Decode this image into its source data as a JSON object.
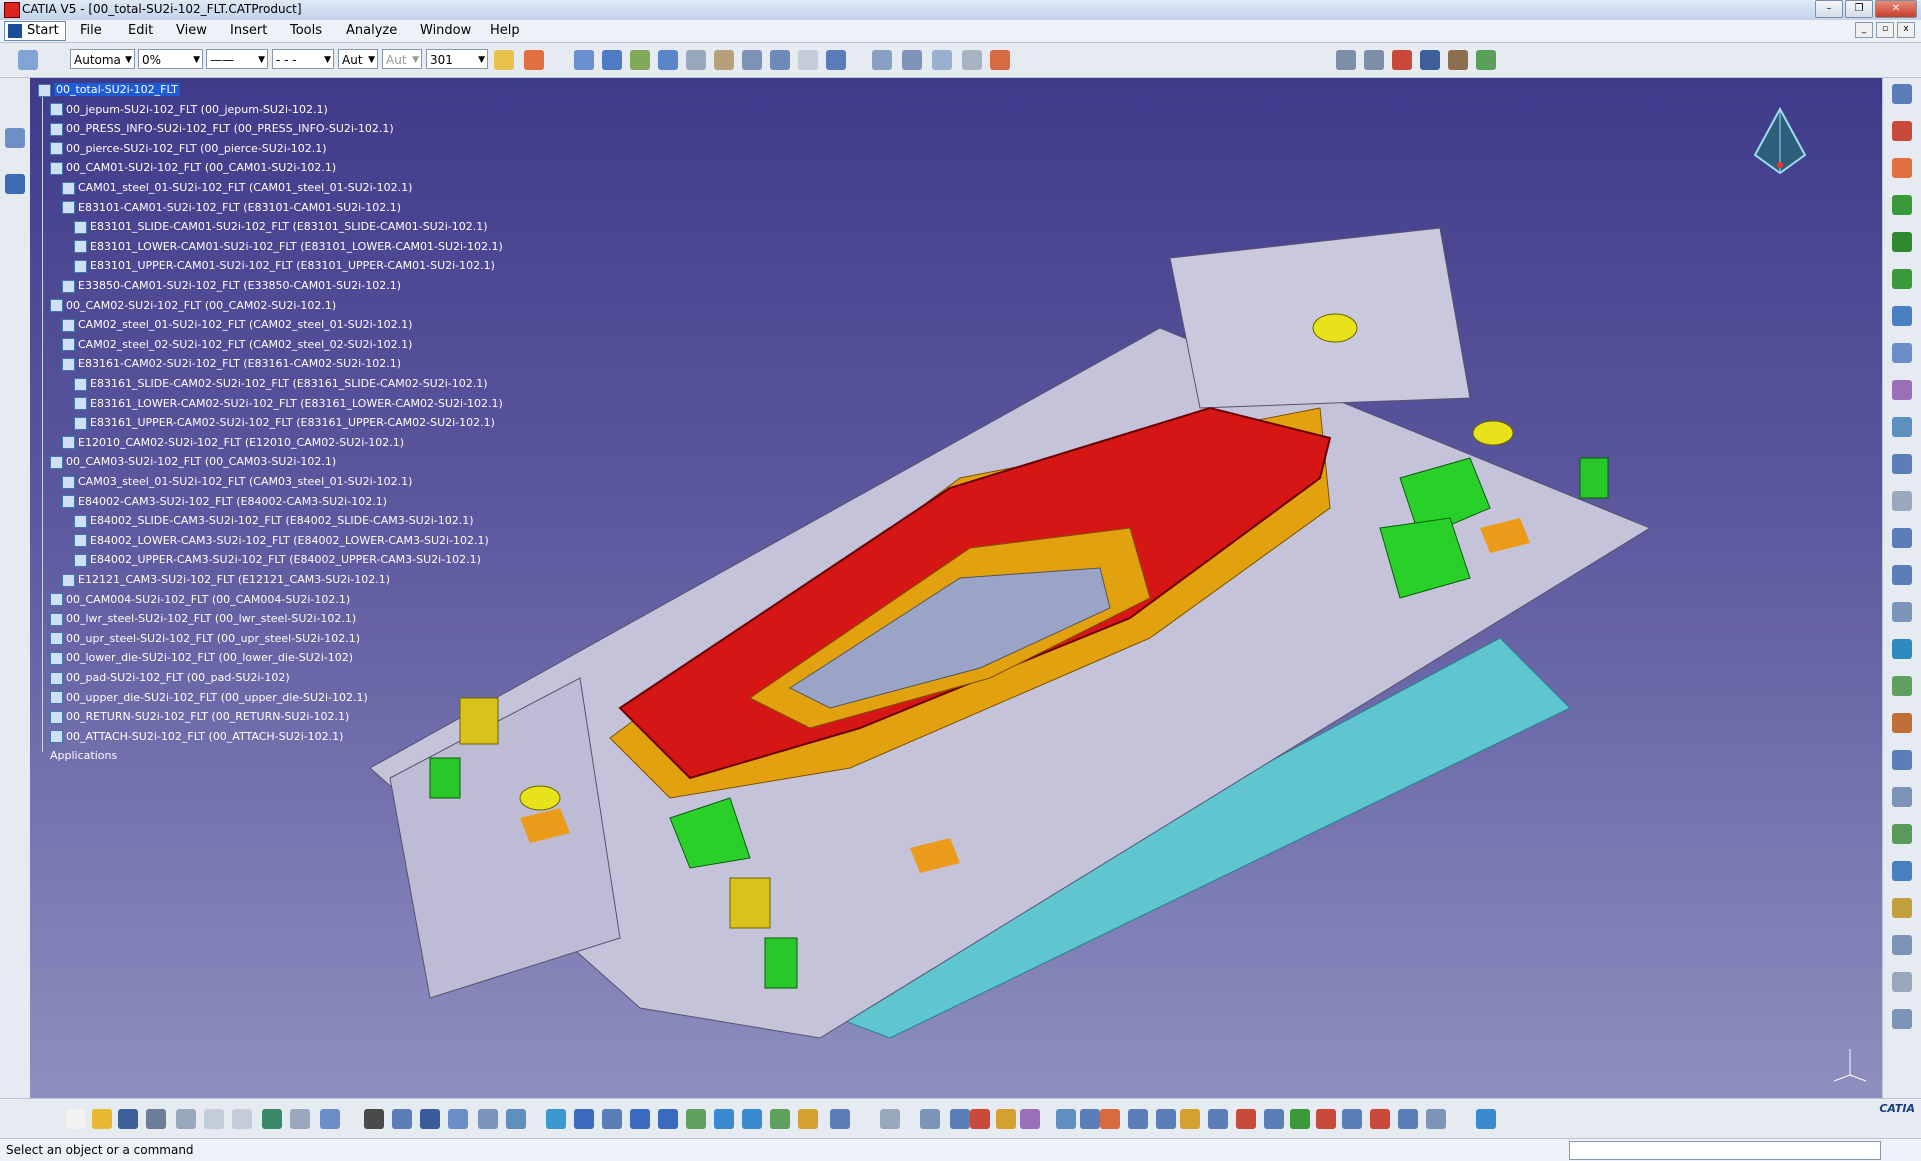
{
  "window": {
    "title": "CATIA V5 - [00_total-SU2i-102_FLT.CATProduct]"
  },
  "menu": {
    "start": "Start",
    "items": [
      "File",
      "Edit",
      "View",
      "Insert",
      "Tools",
      "Analyze",
      "Window",
      "Help"
    ]
  },
  "toolbar": {
    "combo_1": "Automa",
    "combo_2": "0%",
    "combo_3": "Aut",
    "combo_4": "Aut",
    "combo_5": "301"
  },
  "tree": {
    "root": "00_total-SU2i-102_FLT",
    "nodes": [
      "00_jepum-SU2i-102_FLT (00_jepum-SU2i-102.1)",
      "00_PRESS_INFO-SU2i-102_FLT (00_PRESS_INFO-SU2i-102.1)",
      "00_pierce-SU2i-102_FLT (00_pierce-SU2i-102.1)",
      "00_CAM01-SU2i-102_FLT (00_CAM01-SU2i-102.1)",
      "CAM01_steel_01-SU2i-102_FLT (CAM01_steel_01-SU2i-102.1)",
      "E83101-CAM01-SU2i-102_FLT (E83101-CAM01-SU2i-102.1)",
      "E83101_SLIDE-CAM01-SU2i-102_FLT (E83101_SLIDE-CAM01-SU2i-102.1)",
      "E83101_LOWER-CAM01-SU2i-102_FLT (E83101_LOWER-CAM01-SU2i-102.1)",
      "E83101_UPPER-CAM01-SU2i-102_FLT (E83101_UPPER-CAM01-SU2i-102.1)",
      "E33850-CAM01-SU2i-102_FLT (E33850-CAM01-SU2i-102.1)",
      "00_CAM02-SU2i-102_FLT (00_CAM02-SU2i-102.1)",
      "CAM02_steel_01-SU2i-102_FLT (CAM02_steel_01-SU2i-102.1)",
      "CAM02_steel_02-SU2i-102_FLT (CAM02_steel_02-SU2i-102.1)",
      "E83161-CAM02-SU2i-102_FLT (E83161-CAM02-SU2i-102.1)",
      "E83161_SLIDE-CAM02-SU2i-102_FLT (E83161_SLIDE-CAM02-SU2i-102.1)",
      "E83161_LOWER-CAM02-SU2i-102_FLT (E83161_LOWER-CAM02-SU2i-102.1)",
      "E83161_UPPER-CAM02-SU2i-102_FLT (E83161_UPPER-CAM02-SU2i-102.1)",
      "E12010_CAM02-SU2i-102_FLT (E12010_CAM02-SU2i-102.1)",
      "00_CAM03-SU2i-102_FLT (00_CAM03-SU2i-102.1)",
      "CAM03_steel_01-SU2i-102_FLT (CAM03_steel_01-SU2i-102.1)",
      "E84002-CAM3-SU2i-102_FLT (E84002-CAM3-SU2i-102.1)",
      "E84002_SLIDE-CAM3-SU2i-102_FLT (E84002_SLIDE-CAM3-SU2i-102.1)",
      "E84002_LOWER-CAM3-SU2i-102_FLT (E84002_LOWER-CAM3-SU2i-102.1)",
      "E84002_UPPER-CAM3-SU2i-102_FLT (E84002_UPPER-CAM3-SU2i-102.1)",
      "E12121_CAM3-SU2i-102_FLT (E12121_CAM3-SU2i-102.1)",
      "00_CAM004-SU2i-102_FLT (00_CAM004-SU2i-102.1)",
      "00_lwr_steel-SU2i-102_FLT (00_lwr_steel-SU2i-102.1)",
      "00_upr_steel-SU2i-102_FLT (00_upr_steel-SU2i-102.1)",
      "00_lower_die-SU2i-102_FLT (00_lower_die-SU2i-102)",
      "00_pad-SU2i-102_FLT (00_pad-SU2i-102)",
      "00_upper_die-SU2i-102_FLT (00_upper_die-SU2i-102.1)",
      "00_RETURN-SU2i-102_FLT (00_RETURN-SU2i-102.1)",
      "00_ATTACH-SU2i-102_FLT (00_ATTACH-SU2i-102.1)"
    ],
    "applications": "Applications"
  },
  "status": {
    "message": "Select an object or a command"
  },
  "logo": "CATIA"
}
